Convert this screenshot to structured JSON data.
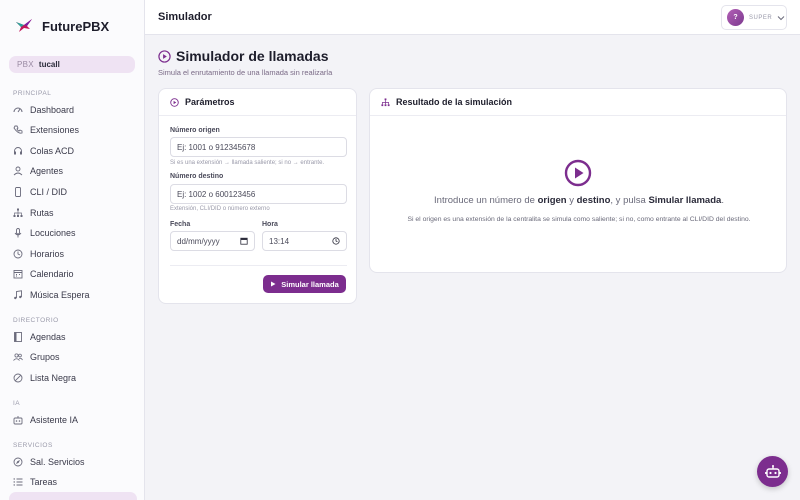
{
  "brand": {
    "name": "FuturePBX"
  },
  "pbx": {
    "key": "PBX",
    "value": "tucall"
  },
  "sidebar": {
    "sections": [
      {
        "label": "PRINCIPAL",
        "items": [
          {
            "label": "Dashboard",
            "icon": "gauge-icon"
          },
          {
            "label": "Extensiones",
            "icon": "phone-icon"
          },
          {
            "label": "Colas ACD",
            "icon": "headset-icon"
          },
          {
            "label": "Agentes",
            "icon": "user-icon"
          },
          {
            "label": "CLI / DID",
            "icon": "mobile-icon"
          },
          {
            "label": "Rutas",
            "icon": "routes-icon"
          },
          {
            "label": "Locuciones",
            "icon": "mic-icon"
          },
          {
            "label": "Horarios",
            "icon": "clock-icon"
          },
          {
            "label": "Calendario",
            "icon": "calendar-icon"
          },
          {
            "label": "Música Espera",
            "icon": "music-icon"
          }
        ]
      },
      {
        "label": "DIRECTORIO",
        "items": [
          {
            "label": "Agendas",
            "icon": "book-icon"
          },
          {
            "label": "Grupos",
            "icon": "users-icon"
          },
          {
            "label": "Lista Negra",
            "icon": "ban-icon"
          }
        ]
      },
      {
        "label": "IA",
        "items": [
          {
            "label": "Asistente IA",
            "icon": "robot-icon"
          }
        ]
      },
      {
        "label": "SERVICIOS",
        "items": [
          {
            "label": "Sal. Servicios",
            "icon": "compass-icon"
          },
          {
            "label": "Tareas",
            "icon": "list-icon"
          }
        ]
      }
    ]
  },
  "topbar": {
    "title": "Simulador",
    "avatar_letter": "?",
    "role": "SUPER"
  },
  "page": {
    "title": "Simulador de llamadas",
    "subtitle": "Simula el enrutamiento de una llamada sin realizarla"
  },
  "params": {
    "title": "Parámetros",
    "origen_label": "Número origen",
    "origen_placeholder": "Ej: 1001 o 912345678",
    "origen_hint": "Si es una extensión → llamada saliente; si no → entrante.",
    "destino_label": "Número destino",
    "destino_placeholder": "Ej: 1002 o 600123456",
    "destino_hint": "Extensión, CLI/DID o número externo",
    "fecha_label": "Fecha",
    "fecha_value": "dd/mm/yyyy",
    "hora_label": "Hora",
    "hora_value": "13:14",
    "submit_label": "Simular llamada"
  },
  "result": {
    "title": "Resultado de la simulación",
    "msg_pre": "Introduce un número de ",
    "msg_origen": "origen",
    "msg_y": " y ",
    "msg_destino": "destino",
    "msg_mid": ", y pulsa ",
    "msg_action": "Simular llamada",
    "msg_end": ".",
    "note": "Si el origen es una extensión de la centralita se simula como saliente; si no, como entrante al CLI/DID del destino."
  },
  "colors": {
    "accent": "#7c2d8e",
    "accent_light": "#efe3f3"
  }
}
